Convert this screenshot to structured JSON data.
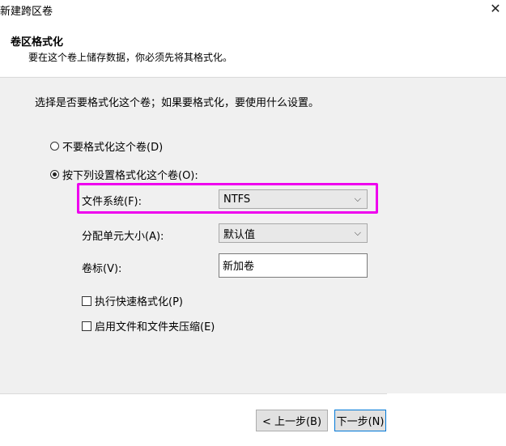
{
  "window": {
    "title": "新建跨区卷",
    "close_glyph": "✕"
  },
  "header": {
    "title": "卷区格式化",
    "subtitle": "要在这个卷上储存数据，你必须先将其格式化。"
  },
  "instruction": "选择是否要格式化这个卷；如果要格式化，要使用什么设置。",
  "options": {
    "no_format": {
      "label": "不要格式化这个卷(D)",
      "selected": false
    },
    "format": {
      "label": "按下列设置格式化这个卷(O):",
      "selected": true
    }
  },
  "fields": {
    "file_system": {
      "label": "文件系统(F):",
      "value": "NTFS"
    },
    "allocation": {
      "label": "分配单元大小(A):",
      "value": "默认值"
    },
    "volume_label": {
      "label": "卷标(V):",
      "value": "新加卷"
    }
  },
  "checkboxes": {
    "quick_format": {
      "label": "执行快速格式化(P)",
      "checked": false
    },
    "compression": {
      "label": "启用文件和文件夹压缩(E)",
      "checked": false
    }
  },
  "buttons": {
    "back": "< 上一步(B)",
    "next": "下一步(N)"
  },
  "icons": {
    "chevron": "⌵"
  },
  "colors": {
    "highlight": "#ee00ee",
    "panel": "#f0f0f0",
    "primary_border": "#0078d7"
  }
}
